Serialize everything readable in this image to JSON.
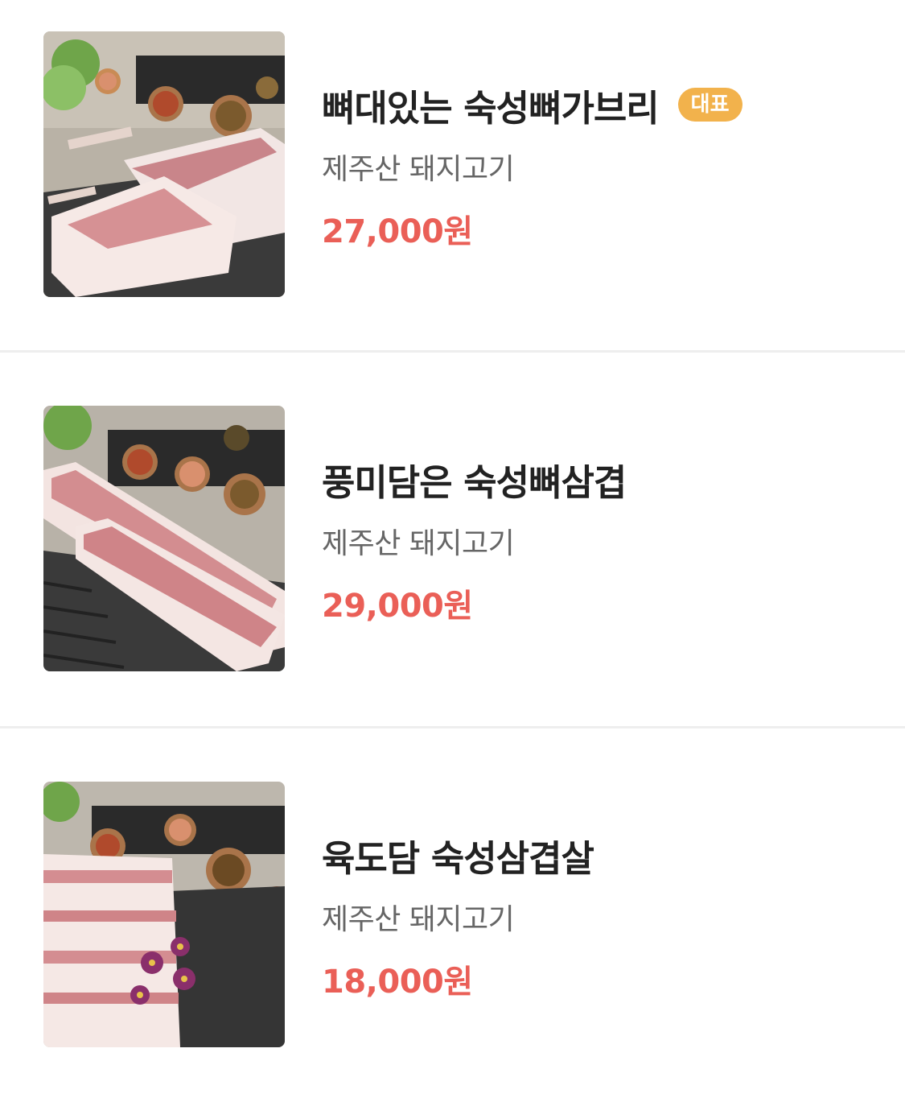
{
  "menu": {
    "items": [
      {
        "name": "뼈대있는 숙성뼈가브리",
        "badge": "대표",
        "description": "제주산 돼지고기",
        "price": "27,000원",
        "image_alt": "photo-bone-in-pork-jowl"
      },
      {
        "name": "풍미담은 숙성뼈삼겹",
        "description": "제주산 돼지고기",
        "price": "29,000원",
        "image_alt": "photo-bone-in-pork-belly"
      },
      {
        "name": "육도담 숙성삼겹살",
        "description": "제주산 돼지고기",
        "price": "18,000원",
        "image_alt": "photo-pork-belly"
      }
    ]
  },
  "colors": {
    "price": "#ea5f57",
    "badge": "#f2b24c",
    "divider": "#eeeeee",
    "title": "#222222",
    "description": "#666666"
  }
}
